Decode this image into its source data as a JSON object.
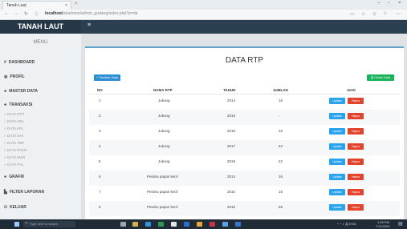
{
  "browser": {
    "tab_title": "Tanah Laut",
    "tab_close": "×",
    "new_tab": "+",
    "url_host": "localhost",
    "url_path": "/skarlomo/admin_gudang/index.php?p=rtp",
    "win_min": "–",
    "win_max": "▫",
    "win_close": "×",
    "back": "←",
    "forward": "→",
    "reload": "↻"
  },
  "app": {
    "brand": "TANAH LAUT",
    "menu_toggle": "≡"
  },
  "sidebar": {
    "menu_title": "MENU",
    "items": [
      {
        "label": "DASHBOARD",
        "icon": "#"
      },
      {
        "label": "PROFIL",
        "icon": "◍"
      },
      {
        "label": "MASTER DATA",
        "icon": "♣"
      },
      {
        "label": "TRANSAKSI",
        "icon": "♣"
      },
      {
        "label": "GRAFIK",
        "icon": "♣"
      },
      {
        "label": "FILTER LAPORAN",
        "icon": "▙"
      },
      {
        "label": "KELUAR",
        "icon": "⏻"
      }
    ],
    "subitems": [
      "DATA RTP",
      "DATA HEL",
      "DATA APL",
      "DATA UHI",
      "DATA TBP",
      "DATA PAKN",
      "DATA MAN",
      "DATA PAL"
    ]
  },
  "main": {
    "title": "DATA RTP",
    "add_button": "+ Tambah Data",
    "print_button": "⎙ Cetak Data",
    "columns": [
      "NO",
      "NAMA RTP",
      "TAHUN",
      "JUMLAH",
      "AKSI"
    ],
    "update_label": "Update",
    "delete_label": "Hapus",
    "rows": [
      {
        "no": "1",
        "nama": "Jukung",
        "tahun": "2014",
        "jumlah": "16"
      },
      {
        "no": "2",
        "nama": "Jukung",
        "tahun": "2015",
        "jumlah": "-"
      },
      {
        "no": "3",
        "nama": "Jukung",
        "tahun": "2016",
        "jumlah": "16"
      },
      {
        "no": "4",
        "nama": "Jukung",
        "tahun": "2017",
        "jumlah": "22"
      },
      {
        "no": "5",
        "nama": "Jukung",
        "tahun": "2018",
        "jumlah": "22"
      },
      {
        "no": "6",
        "nama": "Perahu papan kecil",
        "tahun": "2014",
        "jumlah": "16"
      },
      {
        "no": "7",
        "nama": "Perahu papan kecil",
        "tahun": "2015",
        "jumlah": "15"
      },
      {
        "no": "8",
        "nama": "Perahu papan kecil",
        "tahun": "2016",
        "jumlah": "69"
      }
    ]
  },
  "taskbar": {
    "search_placeholder": "Type here to search",
    "time": "1:59 PM",
    "date": "7/11/2020"
  }
}
